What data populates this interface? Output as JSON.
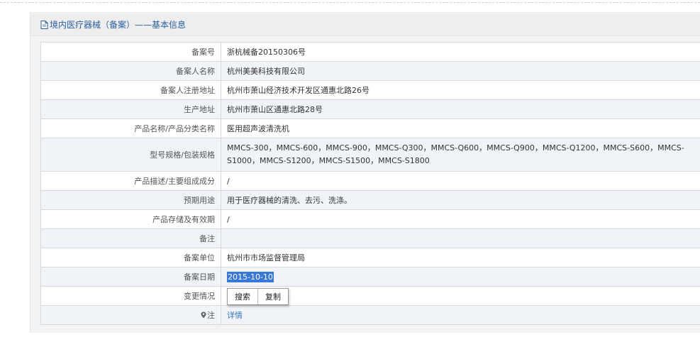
{
  "panel": {
    "title": "境内医疗器械（备案）——基本信息"
  },
  "rows": [
    {
      "label": "备案号",
      "value": "浙杭械备20150306号"
    },
    {
      "label": "备案人名称",
      "value": "杭州美美科技有限公司"
    },
    {
      "label": "备案人注册地址",
      "value": "杭州市萧山经济技术开发区通惠北路26号"
    },
    {
      "label": "生产地址",
      "value": "杭州市萧山区通惠北路28号"
    },
    {
      "label": "产品名称/产品分类名称",
      "value": "医用超声波清洗机"
    },
    {
      "label": "型号规格/包装规格",
      "value": "MMCS-300，MMCS-600，MMCS-900，MMCS-Q300，MMCS-Q600，MMCS-Q900，MMCS-Q1200，MMCS-S600，MMCS-S1000，MMCS-S1200，MMCS-S1500，MMCS-S1800"
    },
    {
      "label": "产品描述/主要组成成分",
      "value": "/"
    },
    {
      "label": "预期用途",
      "value": "用于医疗器械的清洗、去污、洗涤。"
    },
    {
      "label": "产品存储及有效期",
      "value": "/"
    },
    {
      "label": "备注",
      "value": ""
    },
    {
      "label": "备案单位",
      "value": "杭州市市场监督管理局"
    },
    {
      "label": "备案日期",
      "value": "2015-10-10"
    },
    {
      "label": "变更情况",
      "value": ""
    },
    {
      "label": "注",
      "value": "详情"
    }
  ],
  "context_menu": {
    "search_label": "搜索",
    "copy_label": "复制"
  },
  "colors": {
    "title": "#2a5f9e",
    "link": "#3a78c2",
    "selection": "#3a78d7"
  }
}
